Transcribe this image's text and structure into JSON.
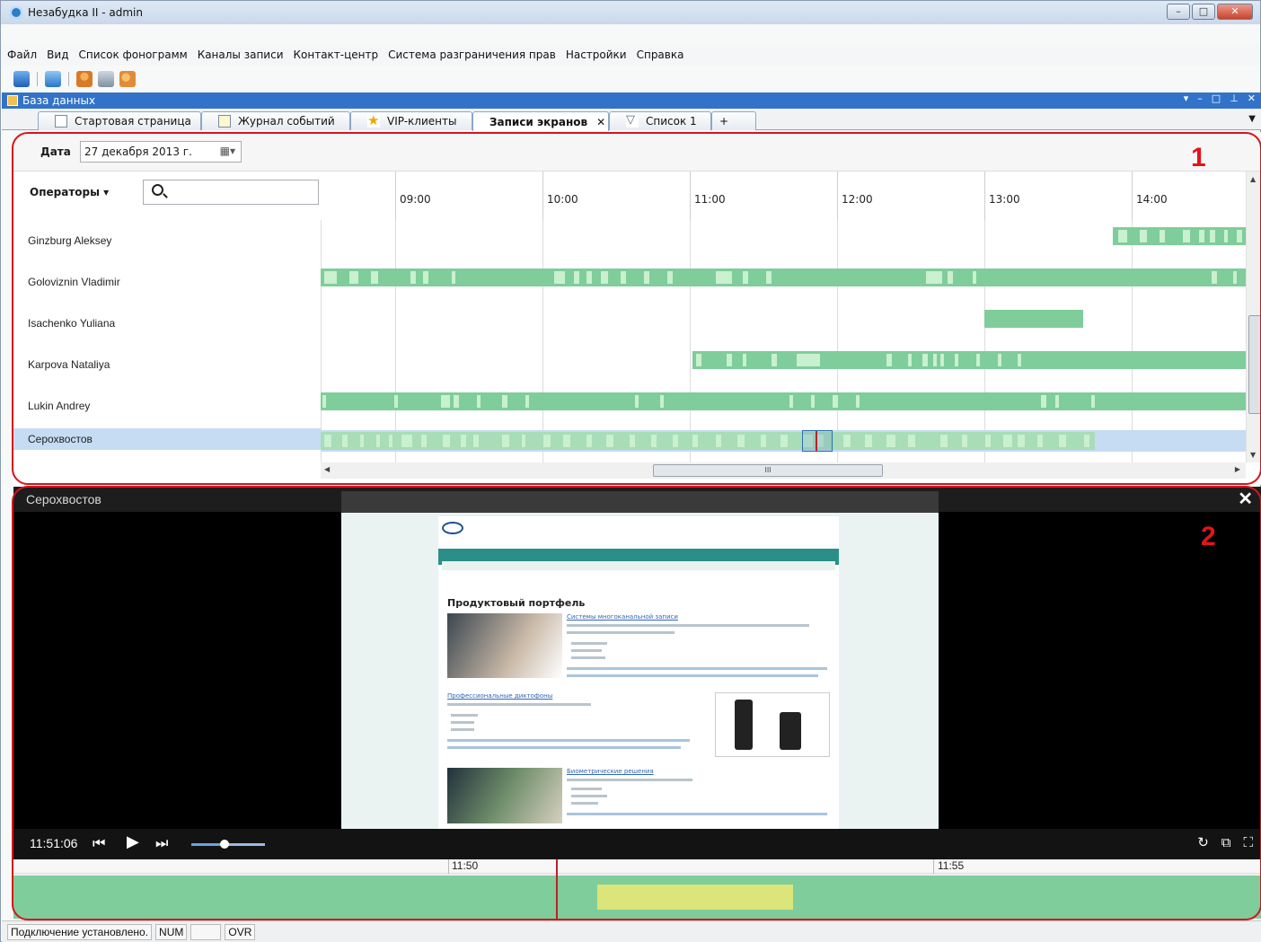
{
  "window": {
    "title": "Незабудка II - admin",
    "min_label": "–",
    "max_label": "□",
    "close_label": "✕"
  },
  "menu": [
    "Файл",
    "Вид",
    "Список фонограмм",
    "Каналы записи",
    "Контакт-центр",
    "Система разграничения прав",
    "Настройки",
    "Справка"
  ],
  "toolbar_icons": [
    "monitor-icon",
    "form-icon",
    "user-icon",
    "network-icon",
    "users-icon"
  ],
  "dock": {
    "title": "База данных",
    "controls": [
      "▾",
      "–",
      "□",
      "⊥",
      "✕"
    ]
  },
  "tabs": [
    {
      "label": "Стартовая страница",
      "active": false,
      "closable": false
    },
    {
      "label": "Журнал событий",
      "active": false,
      "closable": false
    },
    {
      "label": "VIP-клиенты",
      "active": false,
      "closable": false
    },
    {
      "label": "Записи экранов",
      "active": true,
      "closable": true,
      "close_label": "✕"
    },
    {
      "label": "Список 1",
      "active": false,
      "closable": false
    },
    {
      "label": "+",
      "active": false,
      "closable": false
    }
  ],
  "schedule": {
    "date_label": "Дата",
    "date_value": "27 декабря  2013 г.",
    "operators_label": "Операторы ▾",
    "search_placeholder": "",
    "hours": [
      "09:00",
      "10:00",
      "11:00",
      "12:00",
      "13:00",
      "14:00"
    ],
    "operators": [
      {
        "name": "Ginzburg Aleksey",
        "selected": false
      },
      {
        "name": "Goloviznin Vladimir",
        "selected": false
      },
      {
        "name": "Isachenko Yuliana",
        "selected": false
      },
      {
        "name": "Karpova Nataliya",
        "selected": false
      },
      {
        "name": "Lukin Andrey",
        "selected": false
      },
      {
        "name": "Серохвостов",
        "selected": true
      }
    ],
    "scroll_thumb_label": "III"
  },
  "player": {
    "title": "Серохвостов",
    "close_label": "✕",
    "time": "11:51:06",
    "volume_fraction": 0.45,
    "controls": {
      "prev": "⏮",
      "play": "▶",
      "next": "⏭",
      "refresh": "↻",
      "popout": "⧉",
      "fullscreen": "⛶"
    },
    "timeline_labels": [
      "11:50",
      "11:55"
    ],
    "video_page_heading": "Продуктовый портфель",
    "video_links": [
      "Системы многоканальной записи",
      "Профессиональные диктофоны",
      "Биометрические решения"
    ]
  },
  "annotations": [
    "1",
    "2"
  ],
  "status": [
    "Подключение установлено.",
    "NUM",
    "",
    "OVR"
  ],
  "colors": {
    "activity": "#7fcd9a",
    "activity_light": "#c9f0cf",
    "highlight": "#dbe57a",
    "selection": "#c5dcf3",
    "annotation": "#d8131b"
  }
}
